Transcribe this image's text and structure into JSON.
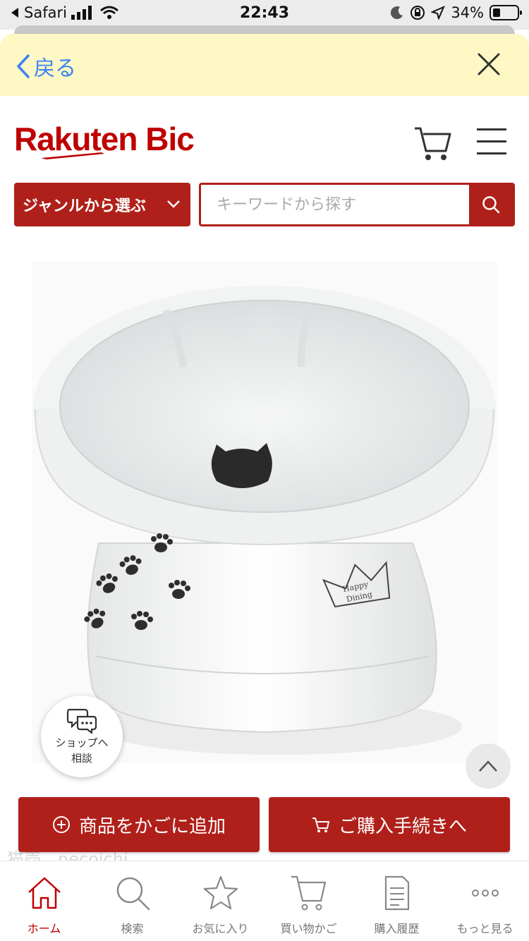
{
  "status_bar": {
    "back_app": "Safari",
    "time": "22:43",
    "battery": "34%"
  },
  "browser": {
    "back_label": "戻る"
  },
  "header": {
    "logo_text": "Rakuten Bic"
  },
  "search": {
    "genre_label": "ジャンルから選ぶ",
    "placeholder": "キーワードから探す"
  },
  "consult": {
    "line1": "ショップへ",
    "line2": "相談"
  },
  "actions": {
    "add_to_cart": "商品をかごに追加",
    "checkout": "ご購入手続きへ"
  },
  "faded_text": "猫壱　necoichi",
  "product_image": {
    "crown_text_1": "Happy",
    "crown_text_2": "Dining"
  },
  "bottom_nav": [
    {
      "label": "ホーム",
      "icon": "home-icon",
      "active": true
    },
    {
      "label": "検索",
      "icon": "search-icon",
      "active": false
    },
    {
      "label": "お気に入り",
      "icon": "star-icon",
      "active": false
    },
    {
      "label": "買い物かご",
      "icon": "cart-icon",
      "active": false
    },
    {
      "label": "購入履歴",
      "icon": "history-icon",
      "active": false
    },
    {
      "label": "もっと見る",
      "icon": "more-icon",
      "active": false
    }
  ],
  "colors": {
    "brand_red": "#bf0000",
    "button_red": "#b0201a",
    "browser_bar": "#fdf8c4",
    "link_blue": "#3b82f6"
  }
}
